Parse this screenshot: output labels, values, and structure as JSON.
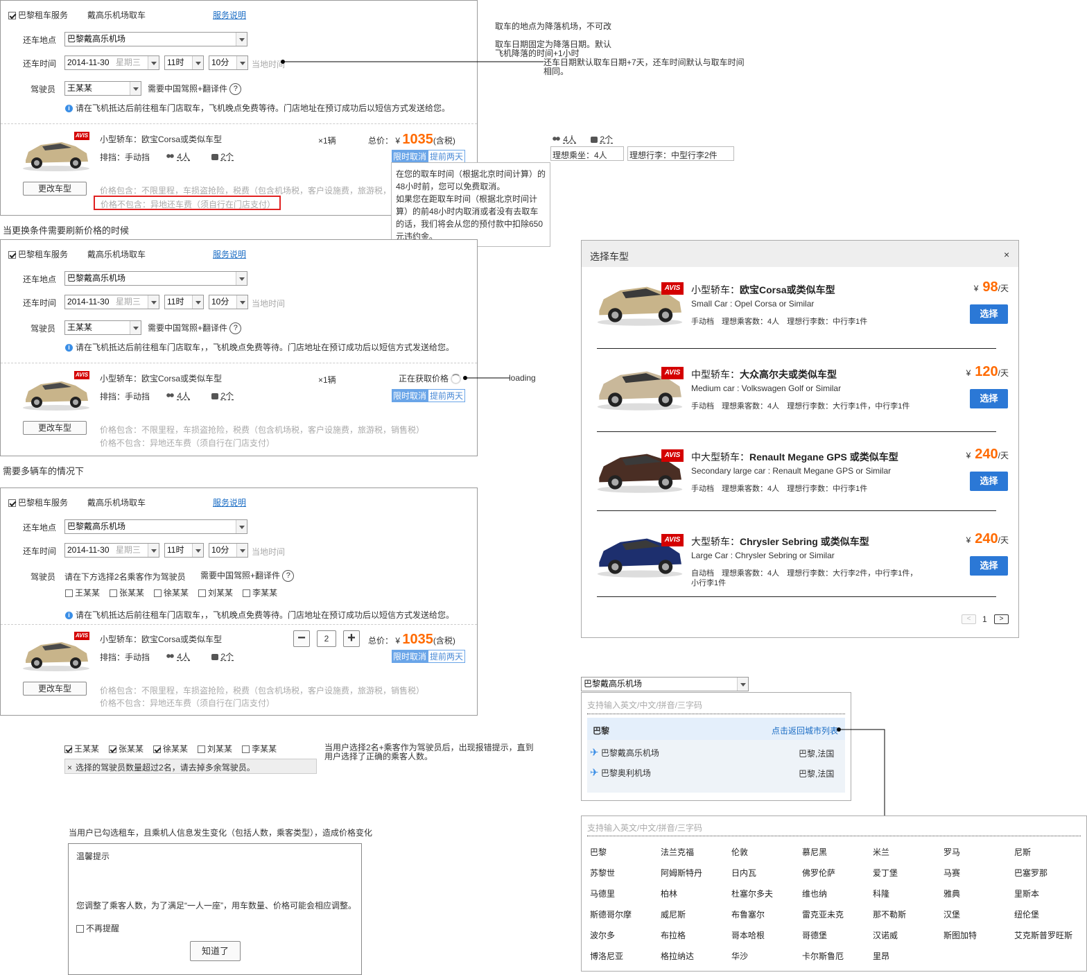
{
  "rental": {
    "service": "巴黎租车服务",
    "pickup": "戴高乐机场取车",
    "service_link": "服务说明",
    "return_place_label": "还车地点",
    "return_place": "巴黎戴高乐机场",
    "return_time_label": "还车时间",
    "date": "2014-11-30",
    "weekday": "星期三",
    "hour": "11时",
    "minute": "10分",
    "local_time": "当地时间",
    "driver_label": "驾驶员",
    "driver": "王某某",
    "license_req": "需要中国驾照+翻译件",
    "help": "?",
    "info": "请在飞机抵达后前往租车门店取车，飞机晚点免费等待。门店地址在预订成功后以短信方式发送给您。",
    "info2": "请在飞机抵达后前往租车门店取车，，飞机晚点免费等待。门店地址在预订成功后以短信方式发送给您。",
    "car_title": "小型轿车：欧宝Corsa或类似车型",
    "gear": "排挡：手动挡",
    "persons": "4人",
    "bags": "2个",
    "qty": "×1辆",
    "total_label": "总价：",
    "currency": "¥",
    "price": "1035",
    "tax": "(含税)",
    "tag1": "限时取消",
    "tag2": "提前两天",
    "change_btn": "更改车型",
    "includes": "价格包含：不限里程，车损盗抢险，税费（包含机场税，客户设施费，旅游税，",
    "includes_full": "价格包含：不限里程，车损盗抢险，税费（包含机场税，客户设施费，旅游税，销售税）",
    "excludes": "价格不包含：异地还车费（须自行在门店支付）",
    "loading_text": "正在获取价格",
    "avis": "AVIS",
    "qty_value": "2",
    "minus": "−",
    "plus": "+"
  },
  "tooltip": {
    "text1": "在您的取车时间（根据北京时间计算）的48小时前，您可以免费取消。",
    "text2": "如果您在距取车时间（根据北京时间计算）的前48小时内取消或者没有去取车的话，我们将会从您的预付款中扣除650元违约金。"
  },
  "section_titles": {
    "refresh": "当更换条件需要刷新价格的时候",
    "multi": "需要多辆车的情况下"
  },
  "annotations": {
    "a1": "取车的地点为降落机场，不可改",
    "a2": "取车日期固定为降落日期。默认",
    "a3": "飞机降落的时间+1小时",
    "a4": "还车日期默认取车日期+7天，还车时间默认与取车时间",
    "a5": "相同。",
    "ideal_seats": "理想乘坐：4人",
    "ideal_bags": "理想行李：中型行李2件",
    "p4": "4人",
    "b2": "2个",
    "loading": "loading",
    "driver_err_note1": "当用户选择2名+乘客作为驾驶员后，出现报错提示，直到",
    "driver_err_note2": "用户选择了正确的乘客人数。",
    "price_change": "当用户已勾选租车，且乘机人信息发生变化（包括人数，乘客类型），造成价格变化"
  },
  "multi": {
    "driver_hint": "请在下方选择2名乘客作为驾驶员",
    "passengers": [
      "王某某",
      "张某某",
      "徐某某",
      "刘某某",
      "李某某"
    ]
  },
  "error": {
    "checked": [
      true,
      true,
      true,
      false,
      false
    ],
    "msg": "选择的驾驶员数量超过2名，请去掉多余驾驶员。",
    "x": "×"
  },
  "dialog": {
    "title": "温馨提示",
    "body": "您调整了乘客人数，为了满足“一人一座”，用车数量、价格可能会相应调整。",
    "no_remind": "不再提醒",
    "ok": "知道了"
  },
  "car_modal": {
    "title": "选择车型",
    "close": "×",
    "select": "选择",
    "per_day": "/天",
    "page": "1",
    "prev": "<",
    "next": ">",
    "cars": [
      {
        "name_cn": "小型轿车：",
        "name_model": "欧宝Corsa或类似车型",
        "name_en": "Small Car : Opel Corsa or Similar",
        "specs": "手动档　理想乘客数：4人　理想行李数：中行李1件",
        "price": "98",
        "color": "#c8b48a"
      },
      {
        "name_cn": "中型轿车：",
        "name_model": "大众高尔夫或类似车型",
        "name_en": "Medium car : Volkswagen Golf or Similar",
        "specs": "手动档　理想乘客数：4人　理想行李数：大行李1件，中行李1件",
        "price": "120",
        "color": "#c9b89a"
      },
      {
        "name_cn": "中大型轿车：",
        "name_model": "Renault Megane GPS 或类似车型",
        "name_en": "Secondary large car : Renault Megane GPS or Similar",
        "specs": "手动档　理想乘客数：4人　理想行李数：中行李1件",
        "price": "240",
        "color": "#4a2e24"
      },
      {
        "name_cn": "大型轿车：",
        "name_model": "Chrysler Sebring 或类似车型",
        "name_en": "Large Car : Chrysler Sebring or Similar",
        "specs": "自动档　理想乘客数：4人　理想行李数：大行李2件，中行李1件，",
        "specs2": "小行李1件",
        "price": "240",
        "color": "#1d2f6e"
      }
    ]
  },
  "airport": {
    "input": "巴黎戴高乐机场",
    "placeholder": "支持输入英文/中文/拼音/三字码",
    "city": "巴黎",
    "back": "点击返回城市列表",
    "items": [
      {
        "name": "巴黎戴高乐机场",
        "loc": "巴黎,法国"
      },
      {
        "name": "巴黎奥利机场",
        "loc": "巴黎,法国"
      }
    ]
  },
  "city_list": {
    "placeholder": "支持输入英文/中文/拼音/三字码",
    "rows": [
      [
        "巴黎",
        "法兰克福",
        "伦敦",
        "慕尼黑",
        "米兰",
        "罗马",
        "尼斯"
      ],
      [
        "苏黎世",
        "阿姆斯特丹",
        "日内瓦",
        "佛罗伦萨",
        "爱丁堡",
        "马赛",
        "巴塞罗那"
      ],
      [
        "马德里",
        "柏林",
        "杜塞尔多夫",
        "维也纳",
        "科隆",
        "雅典",
        "里斯本"
      ],
      [
        "斯德哥尔摩",
        "威尼斯",
        "布鲁塞尔",
        "雷克亚未克",
        "那不勒斯",
        "汉堡",
        "纽伦堡"
      ],
      [
        "波尔多",
        "布拉格",
        "哥本哈根",
        "哥德堡",
        "汉诺威",
        "斯图加特",
        "艾克斯普罗旺斯"
      ],
      [
        "博洛尼亚",
        "格拉纳达",
        "华沙",
        "卡尔斯鲁厄",
        "里昂"
      ]
    ]
  }
}
